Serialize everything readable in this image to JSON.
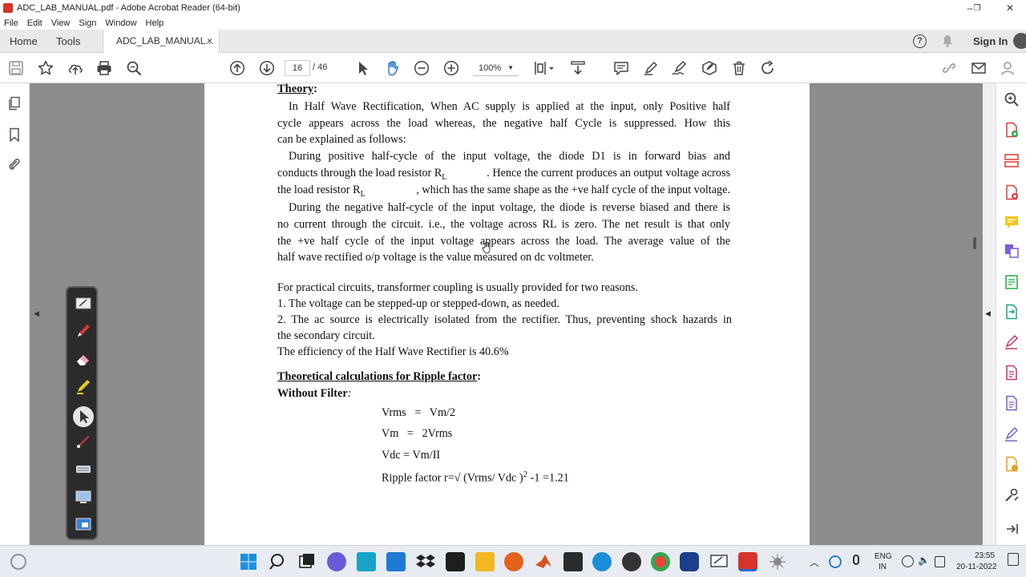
{
  "window": {
    "title": "ADC_LAB_MANUAL.pdf - Adobe Acrobat Reader (64-bit)",
    "minimize": "–",
    "restore": "❐",
    "close": "✕"
  },
  "menu": [
    "File",
    "Edit",
    "View",
    "Sign",
    "Window",
    "Help"
  ],
  "tabs": {
    "home": "Home",
    "tools": "Tools",
    "document": "ADC_LAB_MANUAL...",
    "close": "×"
  },
  "header": {
    "help": "?",
    "signin": "Sign In"
  },
  "toolbar": {
    "page_current": "16",
    "page_total": "/  46",
    "zoom": "100%",
    "zoom_caret": "▼"
  },
  "document": {
    "theory_heading": "Theory",
    "colon": ":",
    "p1": [
      "In Half Wave Rectification, When AC supply is applied at the input, only Positive half",
      "cycle appears across the load whereas, the negative half Cycle is suppressed. How this",
      "can be explained as follows:"
    ],
    "p2": [
      "During positive half-cycle of the input voltage, the diode D1 is in forward bias and",
      "conducts through the load resistor R",
      ". Hence the current produces an output voltage across",
      "the load resistor R",
      ", which has the same shape as the +ve half cycle of the input voltage."
    ],
    "sub_L": "L",
    "p3": [
      "During the negative half-cycle of the input voltage, the diode is reverse biased and there is",
      "no current through the circuit. i.e., the voltage across RL is zero. The net result is that only",
      "the +ve half cycle of the input voltage appears across the load. The average value of the",
      "half wave rectified o/p voltage is the value measured on dc voltmeter."
    ],
    "p4": [
      "For practical circuits, transformer coupling is usually provided for two reasons.",
      "1. The voltage can be stepped-up or stepped-down, as needed.",
      "2. The ac source is electrically isolated from the rectifier. Thus, preventing shock hazards in",
      "the secondary circuit.",
      "The efficiency of the Half Wave Rectifier is 40.6%"
    ],
    "calc_heading": "Theoretical calculations for Ripple factor",
    "without_filter": "Without Filter",
    "without_filter_colon": ":",
    "formulas": [
      "Vrms   =   Vm/2",
      "Vm   =   2Vrms",
      "Vdc = Vm/II"
    ],
    "ripple_a": "Ripple factor r=√ (Vrms/ Vdc )",
    "ripple_sup": "2",
    "ripple_b": " -1 =1.21"
  },
  "collapse_left": "◀",
  "collapse_right": "◀",
  "tray": {
    "lang1": "ENG",
    "lang2": "IN",
    "time": "23:55",
    "date": "20-11-2022"
  },
  "colors": {
    "accent_red": "#d8322a",
    "doc_gray": "#8c8c8c"
  }
}
